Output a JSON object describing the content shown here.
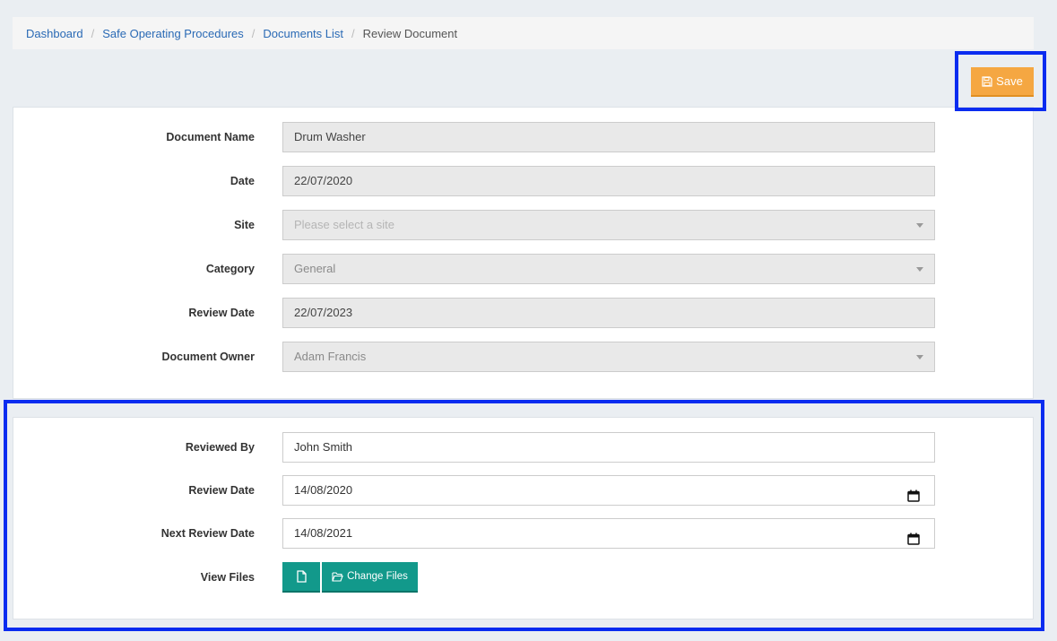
{
  "breadcrumb": {
    "items": [
      "Dashboard",
      "Safe Operating Procedures",
      "Documents List"
    ],
    "current": "Review Document",
    "separator": "/"
  },
  "toolbar": {
    "save_label": "Save",
    "save_color": "#f5a742"
  },
  "document": {
    "name_label": "Document Name",
    "name_value": "Drum Washer",
    "date_label": "Date",
    "date_value": "22/07/2020",
    "site_label": "Site",
    "site_placeholder": "Please select a site",
    "category_label": "Category",
    "category_value": "General",
    "review_date_label": "Review Date",
    "review_date_value": "22/07/2023",
    "owner_label": "Document Owner",
    "owner_value": "Adam Francis"
  },
  "review": {
    "reviewed_by_label": "Reviewed By",
    "reviewed_by_value": "John Smith",
    "review_date_label": "Review Date",
    "review_date_value": "14/08/2020",
    "next_review_label": "Next Review Date",
    "next_review_value": "14/08/2021",
    "view_files_label": "View Files",
    "change_files_label": "Change Files",
    "button_color": "#12998b"
  },
  "icons": {
    "save": "floppy-disk-icon",
    "file": "file-icon",
    "folder": "folder-open-icon",
    "calendar": "calendar-icon",
    "caret": "caret-down-icon"
  }
}
